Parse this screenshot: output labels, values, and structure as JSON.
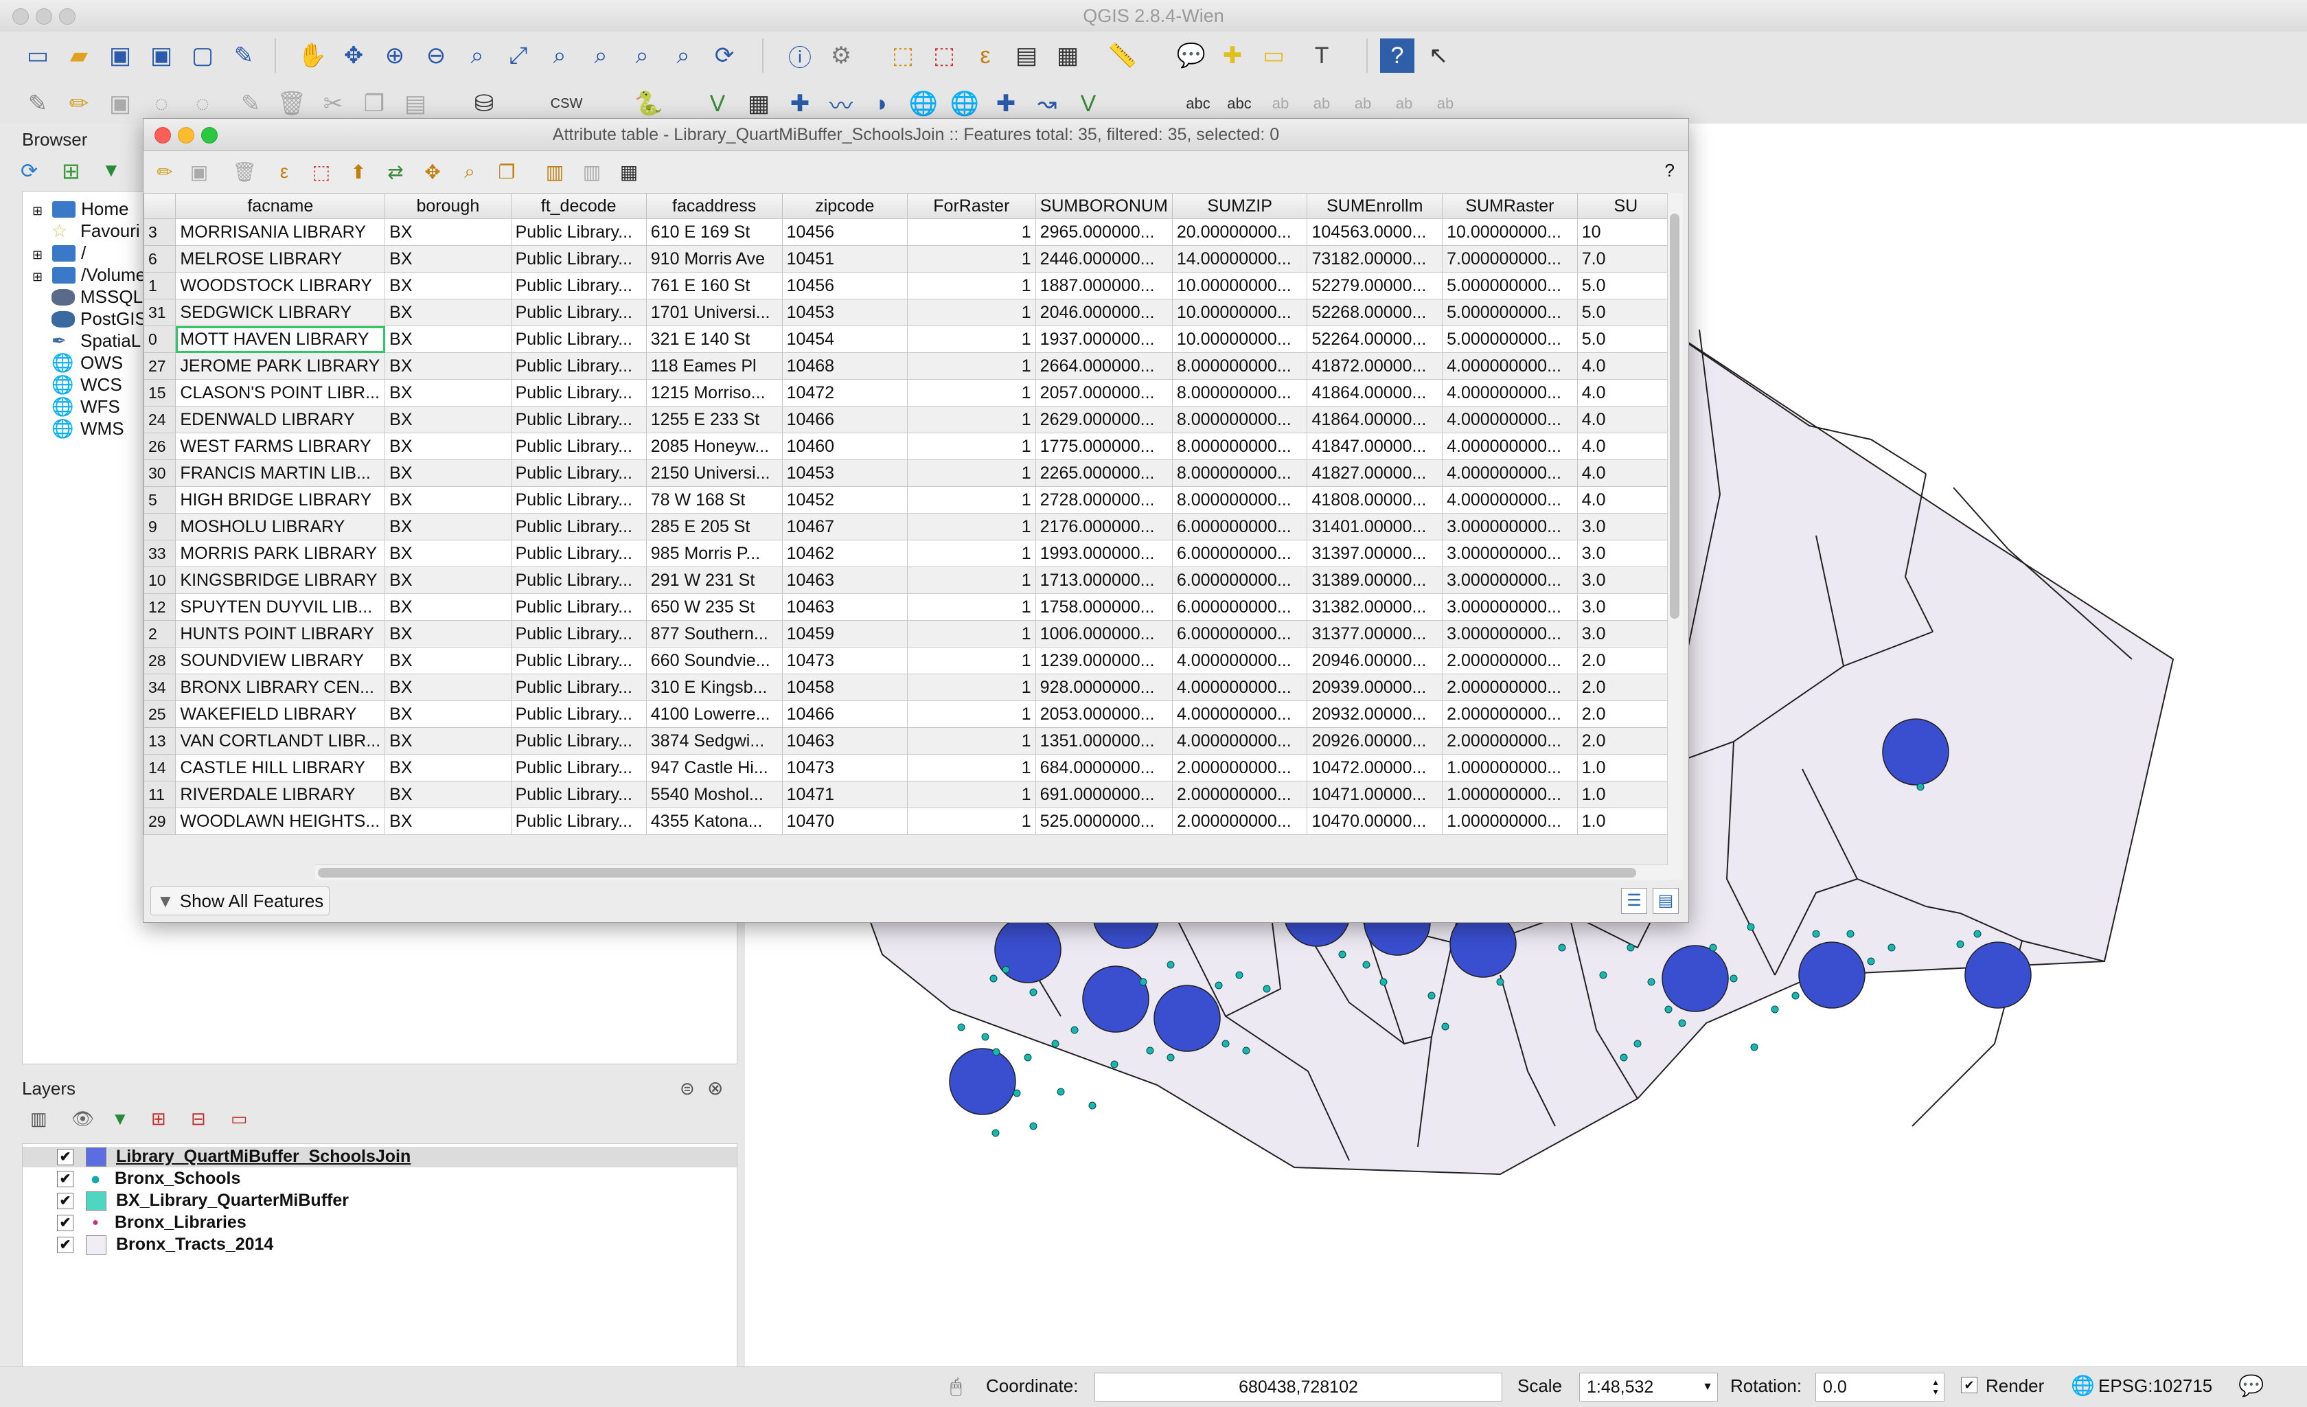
{
  "app": {
    "title": "QGIS 2.8.4-Wien"
  },
  "browser": {
    "title": "Browser",
    "items": [
      "Home",
      "Favouri",
      "/",
      "/Volume",
      "MSSQL",
      "PostGIS",
      "SpatiaL",
      "OWS",
      "WCS",
      "WFS",
      "WMS"
    ]
  },
  "layers": {
    "title": "Layers",
    "items": [
      {
        "name": "Library_QuartMiBuffer_SchoolsJoin",
        "color": "#4b5fd6"
      },
      {
        "name": "Bronx_Schools",
        "color": "#20b5b5"
      },
      {
        "name": "BX_Library_QuarterMiBuffer",
        "color": "#4fd6c3"
      },
      {
        "name": "Bronx_Libraries",
        "color": "#c0308a"
      },
      {
        "name": "Bronx_Tracts_2014",
        "color": "#ece8f0"
      }
    ]
  },
  "attribute_table": {
    "title": "Attribute table - Library_QuartMiBuffer_SchoolsJoin :: Features total: 35, filtered: 35, selected: 0",
    "help": "?",
    "columns": [
      "facname",
      "borough",
      "ft_decode",
      "facaddress",
      "zipcode",
      "ForRaster",
      "SUMBORONUM",
      "SUMZIP",
      "SUMEnrollm",
      "SUMRaster",
      "SU"
    ],
    "rows": [
      [
        "3",
        "MORRISANIA LIBRARY",
        "BX",
        "Public Library...",
        "610 E 169 St",
        "10456",
        "1",
        "2965.000000...",
        "20.00000000...",
        "104563.0000...",
        "10.00000000...",
        "10"
      ],
      [
        "6",
        "MELROSE LIBRARY",
        "BX",
        "Public Library...",
        "910 Morris Ave",
        "10451",
        "1",
        "2446.000000...",
        "14.00000000...",
        "73182.00000...",
        "7.000000000...",
        "7.0"
      ],
      [
        "1",
        "WOODSTOCK LIBRARY",
        "BX",
        "Public Library...",
        "761 E 160 St",
        "10456",
        "1",
        "1887.000000...",
        "10.00000000...",
        "52279.00000...",
        "5.000000000...",
        "5.0"
      ],
      [
        "31",
        "SEDGWICK LIBRARY",
        "BX",
        "Public Library...",
        "1701 Universi...",
        "10453",
        "1",
        "2046.000000...",
        "10.00000000...",
        "52268.00000...",
        "5.000000000...",
        "5.0"
      ],
      [
        "0",
        "MOTT HAVEN LIBRARY",
        "BX",
        "Public Library...",
        "321 E 140 St",
        "10454",
        "1",
        "1937.000000...",
        "10.00000000...",
        "52264.00000...",
        "5.000000000...",
        "5.0"
      ],
      [
        "27",
        "JEROME PARK LIBRARY",
        "BX",
        "Public Library...",
        "118 Eames Pl",
        "10468",
        "1",
        "2664.000000...",
        "8.000000000...",
        "41872.00000...",
        "4.000000000...",
        "4.0"
      ],
      [
        "15",
        "CLASON'S POINT LIBR...",
        "BX",
        "Public Library...",
        "1215 Morriso...",
        "10472",
        "1",
        "2057.000000...",
        "8.000000000...",
        "41864.00000...",
        "4.000000000...",
        "4.0"
      ],
      [
        "24",
        "EDENWALD LIBRARY",
        "BX",
        "Public Library...",
        "1255 E 233 St",
        "10466",
        "1",
        "2629.000000...",
        "8.000000000...",
        "41864.00000...",
        "4.000000000...",
        "4.0"
      ],
      [
        "26",
        "WEST FARMS LIBRARY",
        "BX",
        "Public Library...",
        "2085 Honeyw...",
        "10460",
        "1",
        "1775.000000...",
        "8.000000000...",
        "41847.00000...",
        "4.000000000...",
        "4.0"
      ],
      [
        "30",
        "FRANCIS MARTIN LIB...",
        "BX",
        "Public Library...",
        "2150 Universi...",
        "10453",
        "1",
        "2265.000000...",
        "8.000000000...",
        "41827.00000...",
        "4.000000000...",
        "4.0"
      ],
      [
        "5",
        "HIGH BRIDGE LIBRARY",
        "BX",
        "Public Library...",
        "78 W 168 St",
        "10452",
        "1",
        "2728.000000...",
        "8.000000000...",
        "41808.00000...",
        "4.000000000...",
        "4.0"
      ],
      [
        "9",
        "MOSHOLU LIBRARY",
        "BX",
        "Public Library...",
        "285 E 205 St",
        "10467",
        "1",
        "2176.000000...",
        "6.000000000...",
        "31401.00000...",
        "3.000000000...",
        "3.0"
      ],
      [
        "33",
        "MORRIS PARK LIBRARY",
        "BX",
        "Public Library...",
        "985 Morris P...",
        "10462",
        "1",
        "1993.000000...",
        "6.000000000...",
        "31397.00000...",
        "3.000000000...",
        "3.0"
      ],
      [
        "10",
        "KINGSBRIDGE LIBRARY",
        "BX",
        "Public Library...",
        "291 W 231 St",
        "10463",
        "1",
        "1713.000000...",
        "6.000000000...",
        "31389.00000...",
        "3.000000000...",
        "3.0"
      ],
      [
        "12",
        "SPUYTEN DUYVIL LIB...",
        "BX",
        "Public Library...",
        "650 W 235 St",
        "10463",
        "1",
        "1758.000000...",
        "6.000000000...",
        "31382.00000...",
        "3.000000000...",
        "3.0"
      ],
      [
        "2",
        "HUNTS POINT LIBRARY",
        "BX",
        "Public Library...",
        "877 Southern...",
        "10459",
        "1",
        "1006.000000...",
        "6.000000000...",
        "31377.00000...",
        "3.000000000...",
        "3.0"
      ],
      [
        "28",
        "SOUNDVIEW LIBRARY",
        "BX",
        "Public Library...",
        "660 Soundvie...",
        "10473",
        "1",
        "1239.000000...",
        "4.000000000...",
        "20946.00000...",
        "2.000000000...",
        "2.0"
      ],
      [
        "34",
        "BRONX LIBRARY CEN...",
        "BX",
        "Public Library...",
        "310 E Kingsb...",
        "10458",
        "1",
        "928.0000000...",
        "4.000000000...",
        "20939.00000...",
        "2.000000000...",
        "2.0"
      ],
      [
        "25",
        "WAKEFIELD LIBRARY",
        "BX",
        "Public Library...",
        "4100 Lowerre...",
        "10466",
        "1",
        "2053.000000...",
        "4.000000000...",
        "20932.00000...",
        "2.000000000...",
        "2.0"
      ],
      [
        "13",
        "VAN CORTLANDT LIBR...",
        "BX",
        "Public Library...",
        "3874 Sedgwi...",
        "10463",
        "1",
        "1351.000000...",
        "4.000000000...",
        "20926.00000...",
        "2.000000000...",
        "2.0"
      ],
      [
        "14",
        "CASTLE HILL LIBRARY",
        "BX",
        "Public Library...",
        "947 Castle Hi...",
        "10473",
        "1",
        "684.0000000...",
        "2.000000000...",
        "10472.00000...",
        "1.000000000...",
        "1.0"
      ],
      [
        "11",
        "RIVERDALE LIBRARY",
        "BX",
        "Public Library...",
        "5540 Moshol...",
        "10471",
        "1",
        "691.0000000...",
        "2.000000000...",
        "10471.00000...",
        "1.000000000...",
        "1.0"
      ],
      [
        "29",
        "WOODLAWN HEIGHTS...",
        "BX",
        "Public Library...",
        "4355 Katona...",
        "10470",
        "1",
        "525.0000000...",
        "2.000000000...",
        "10470.00000...",
        "1.000000000...",
        "1.0"
      ]
    ],
    "show_all_label": "Show All Features"
  },
  "status": {
    "coordinate_label": "Coordinate:",
    "coordinate_value": "680438,728102",
    "scale_label": "Scale",
    "scale_value": "1:48,532",
    "rotation_label": "Rotation:",
    "rotation_value": "0.0",
    "render_label": "Render",
    "crs": "EPSG:102715"
  },
  "colors": {
    "buffer": "#3a4fd0",
    "school": "#18b8b0",
    "tract": "#ece9f2"
  }
}
